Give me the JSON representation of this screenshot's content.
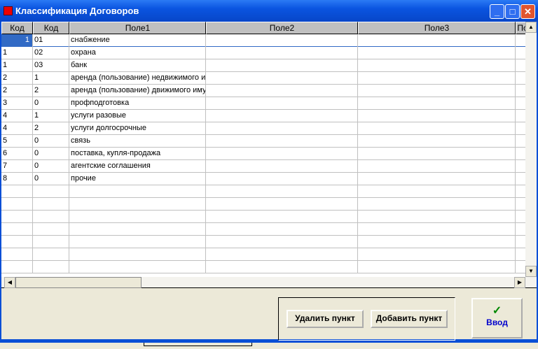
{
  "window": {
    "title": "Классификация Договоров",
    "minimize": "_",
    "maximize": "□",
    "close": "✕"
  },
  "grid": {
    "headers": [
      "Код",
      "Код",
      "Поле1",
      "Поле2",
      "Поле3",
      "По"
    ],
    "rows": [
      [
        "1",
        "01",
        "снабжение",
        "",
        ""
      ],
      [
        "1",
        "02",
        "охрана",
        "",
        ""
      ],
      [
        "1",
        "03",
        "банк",
        "",
        ""
      ],
      [
        "2",
        "1",
        "аренда (пользование) недвижимого имущества",
        "",
        ""
      ],
      [
        "2",
        "2",
        "аренда (пользование) движимого имущества",
        "",
        ""
      ],
      [
        "3",
        "0",
        "профподготовка",
        "",
        ""
      ],
      [
        "4",
        "1",
        "услуги разовые",
        "",
        ""
      ],
      [
        "4",
        "2",
        "услуги долгосрочные",
        "",
        ""
      ],
      [
        "5",
        "0",
        "связь",
        "",
        ""
      ],
      [
        "6",
        "0",
        "поставка, купля-продажа",
        "",
        ""
      ],
      [
        "7",
        "0",
        "агентские соглашения",
        "",
        ""
      ],
      [
        "8",
        "0",
        "прочие",
        "",
        ""
      ]
    ],
    "empty_rows": 7
  },
  "buttons": {
    "delete": "Удалить пункт",
    "add": "Добавить пункт",
    "enter": "Ввод",
    "enter_icon": "✓"
  }
}
